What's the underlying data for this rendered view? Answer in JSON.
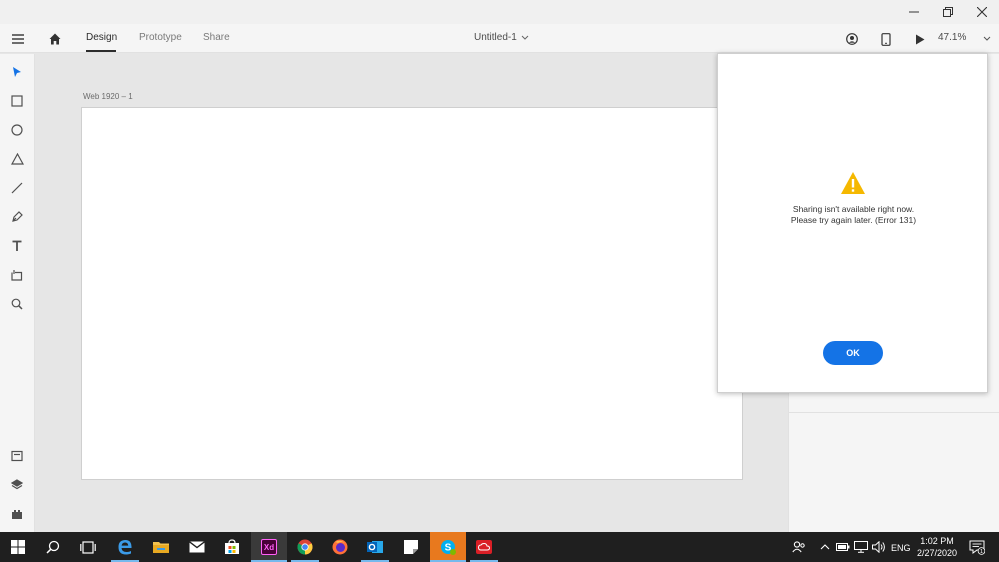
{
  "window": {
    "controls": [
      "minimize",
      "restore",
      "close"
    ]
  },
  "header": {
    "tabs": [
      {
        "label": "Design",
        "active": true
      },
      {
        "label": "Prototype",
        "active": false
      },
      {
        "label": "Share",
        "active": false
      }
    ],
    "doc_title": "Untitled-1",
    "zoom": "47.1%"
  },
  "tools": [
    "select-icon",
    "rectangle-icon",
    "ellipse-icon",
    "polygon-icon",
    "line-icon",
    "pen-icon",
    "text-icon",
    "artboard-icon",
    "zoom-icon"
  ],
  "bottom_tools": [
    "assets-icon",
    "layers-icon",
    "plugins-icon"
  ],
  "canvas": {
    "artboard_label": "Web 1920 – 1"
  },
  "dialog": {
    "line1": "Sharing isn't available right now.",
    "line2": "Please try again later.  (Error 131)",
    "ok_label": "OK"
  },
  "taskbar": {
    "tray_lang": "ENG",
    "time": "1:02 PM",
    "date": "2/27/2020",
    "notification_count": "1"
  },
  "colors": {
    "accent": "#1473e6",
    "warning": "#f5b800",
    "xd_brand": "#470137"
  }
}
